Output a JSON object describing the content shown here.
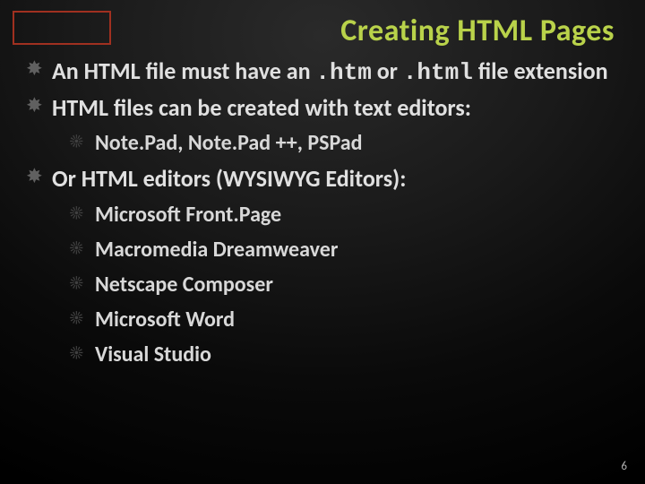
{
  "title": "Creating HTML Pages",
  "bullets": [
    {
      "prefix": "An HTML file must have an ",
      "code1": ".htm",
      "mid": " or ",
      "code2": ".html",
      "suffix": " file extension"
    },
    {
      "text": "HTML files can be created with text editors:"
    },
    {
      "text": "Or HTML editors (WYSIWYG Editors):"
    }
  ],
  "sub1": [
    {
      "text": "Note.Pad, Note.Pad ++, PSPad"
    }
  ],
  "sub2": [
    {
      "text": "Microsoft Front.Page"
    },
    {
      "text": "Macromedia Dreamweaver"
    },
    {
      "text": "Netscape Composer"
    },
    {
      "text": "Microsoft Word"
    },
    {
      "text": "Visual Studio"
    }
  ],
  "page_number": "6"
}
